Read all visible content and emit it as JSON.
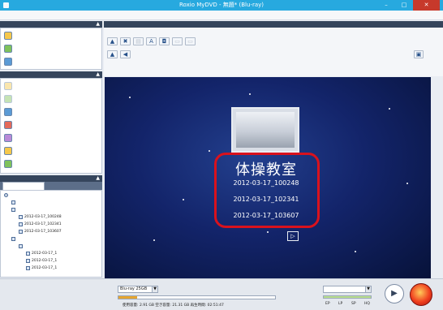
{
  "window": {
    "title": "Roxio MyDVD - 無題* (Blu-ray)"
  },
  "menubar": {
    "items": []
  },
  "panels": {
    "tasks_header": "",
    "edit_header": "",
    "project_header": "",
    "preview_header": ""
  },
  "tasks": [
    {
      "label": "",
      "icon": "add-movie-icon",
      "disabled": false
    },
    {
      "label": "",
      "icon": "slideshow-icon",
      "disabled": false
    },
    {
      "label": "",
      "icon": "intro-movie-icon",
      "disabled": false
    }
  ],
  "edit_tasks": [
    {
      "label": "",
      "icon": "edit-movie-icon",
      "disabled": true
    },
    {
      "label": "",
      "icon": "edit-chapter-icon",
      "disabled": true
    },
    {
      "label": "",
      "icon": "menu-style-icon",
      "disabled": false
    },
    {
      "label": "",
      "icon": "button-style-icon",
      "disabled": false
    },
    {
      "label": "",
      "icon": "menu-background-icon",
      "disabled": false
    },
    {
      "label": "",
      "icon": "menu-audio-icon",
      "disabled": false
    },
    {
      "label": "",
      "icon": "submenu-icon",
      "disabled": false
    }
  ],
  "project_tabs": {
    "menu": "",
    "movie": ""
  },
  "tree": [
    {
      "label": "",
      "indent": 0,
      "highlight": false,
      "icon": "disc"
    },
    {
      "label": "",
      "indent": 1,
      "highlight": false,
      "icon": "item"
    },
    {
      "label": "",
      "indent": 1,
      "highlight": true,
      "icon": "item"
    },
    {
      "label": "2012-03-17_100248",
      "indent": 2,
      "highlight": false,
      "icon": "item"
    },
    {
      "label": "2012-03-17_102341",
      "indent": 2,
      "highlight": false,
      "icon": "item"
    },
    {
      "label": "2012-03-17_103607",
      "indent": 2,
      "highlight": false,
      "icon": "item"
    },
    {
      "label": "",
      "indent": 1,
      "highlight": false,
      "icon": "item"
    },
    {
      "label": "",
      "indent": 2,
      "highlight": false,
      "icon": "item"
    },
    {
      "label": "2012-03-17_1",
      "indent": 3,
      "highlight": false,
      "icon": "item"
    },
    {
      "label": "2012-03-17_1",
      "indent": 3,
      "highlight": false,
      "icon": "item"
    },
    {
      "label": "2012-03-17_1",
      "indent": 3,
      "highlight": false,
      "icon": "item"
    }
  ],
  "preview_toolbar": [
    {
      "name": "add-item-button",
      "glyph": "▲",
      "disabled": false
    },
    {
      "name": "delete-button",
      "glyph": "✖",
      "disabled": false
    },
    {
      "name": "menu-layout-button",
      "glyph": "▤",
      "disabled": true
    },
    {
      "name": "text-style-button",
      "glyph": "A",
      "disabled": false
    },
    {
      "name": "frame-button",
      "glyph": "◘",
      "disabled": false
    },
    {
      "name": "disabled-tool-1",
      "glyph": "▭",
      "disabled": true
    },
    {
      "name": "disabled-tool-2",
      "glyph": "▭",
      "disabled": true
    }
  ],
  "preview_toolbar2": [
    {
      "name": "play-preview-button",
      "glyph": "▲",
      "disabled": false
    },
    {
      "name": "audio-button",
      "glyph": "◀",
      "disabled": false
    }
  ],
  "preview": {
    "title": "体操教室",
    "entries": [
      "2012-03-17_100248",
      "2012-03-17_102341",
      "2012-03-17_103607"
    ],
    "next_glyph": "▷"
  },
  "footer": {
    "disc_size_label": "",
    "disc_size_value": "Blu-ray 25GB",
    "usage_text": "使用容量: 2.91 GB  空き容量: 21.31 GB  再生時間: 02:51:47",
    "capacity_fraction": 0.12,
    "quality_label": "",
    "quality_value": "",
    "quality_marks": [
      "EP",
      "LP",
      "SP",
      "HQ"
    ]
  },
  "colors": {
    "titlebar": "#27a9df",
    "panel_header": "#35455c",
    "highlight_ring": "#d9121d",
    "capacity_fill": "#e6a530"
  }
}
